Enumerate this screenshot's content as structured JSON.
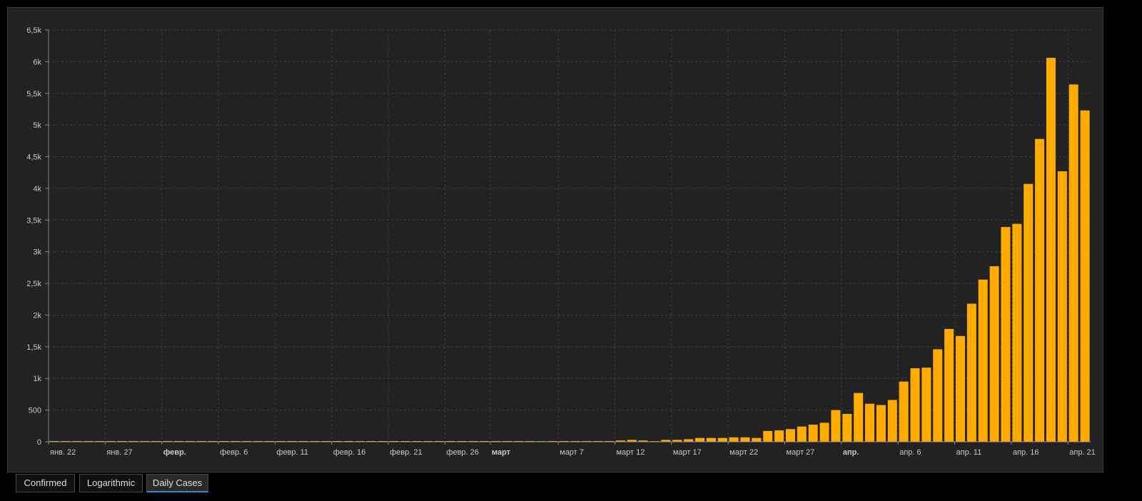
{
  "chart_data": {
    "type": "bar",
    "y_ticks": [
      {
        "value": 0,
        "label": "0"
      },
      {
        "value": 500,
        "label": "500"
      },
      {
        "value": 1000,
        "label": "1k"
      },
      {
        "value": 1500,
        "label": "1,5k"
      },
      {
        "value": 2000,
        "label": "2k"
      },
      {
        "value": 2500,
        "label": "2,5k"
      },
      {
        "value": 3000,
        "label": "3k"
      },
      {
        "value": 3500,
        "label": "3,5k"
      },
      {
        "value": 4000,
        "label": "4k"
      },
      {
        "value": 4500,
        "label": "4,5k"
      },
      {
        "value": 5000,
        "label": "5k"
      },
      {
        "value": 5500,
        "label": "5,5k"
      },
      {
        "value": 6000,
        "label": "6k"
      },
      {
        "value": 6500,
        "label": "6,5k"
      }
    ],
    "ylim": [
      0,
      6500
    ],
    "x_ticks": [
      {
        "index": 0,
        "label": "янв. 22",
        "bold": false
      },
      {
        "index": 5,
        "label": "янв. 27",
        "bold": false
      },
      {
        "index": 10,
        "label": "февр.",
        "bold": true
      },
      {
        "index": 15,
        "label": "февр. 6",
        "bold": false
      },
      {
        "index": 20,
        "label": "февр. 11",
        "bold": false
      },
      {
        "index": 25,
        "label": "февр. 16",
        "bold": false
      },
      {
        "index": 30,
        "label": "февр. 21",
        "bold": false
      },
      {
        "index": 35,
        "label": "февр. 26",
        "bold": false
      },
      {
        "index": 39,
        "label": "март",
        "bold": true
      },
      {
        "index": 45,
        "label": "март 7",
        "bold": false
      },
      {
        "index": 50,
        "label": "март 12",
        "bold": false
      },
      {
        "index": 55,
        "label": "март 17",
        "bold": false
      },
      {
        "index": 60,
        "label": "март 22",
        "bold": false
      },
      {
        "index": 65,
        "label": "март 27",
        "bold": false
      },
      {
        "index": 70,
        "label": "апр.",
        "bold": true
      },
      {
        "index": 75,
        "label": "апр. 6",
        "bold": false
      },
      {
        "index": 80,
        "label": "апр. 11",
        "bold": false
      },
      {
        "index": 85,
        "label": "апр. 16",
        "bold": false
      },
      {
        "index": 90,
        "label": "апр. 21",
        "bold": false
      }
    ],
    "values": [
      0,
      0,
      0,
      0,
      0,
      0,
      0,
      0,
      0,
      0,
      0,
      0,
      0,
      0,
      0,
      0,
      0,
      0,
      0,
      0,
      0,
      0,
      0,
      0,
      0,
      0,
      0,
      0,
      0,
      0,
      0,
      0,
      0,
      0,
      0,
      0,
      0,
      0,
      0,
      0,
      0,
      0,
      0,
      10,
      0,
      0,
      0,
      0,
      0,
      0,
      20,
      30,
      20,
      10,
      30,
      30,
      40,
      60,
      60,
      60,
      70,
      70,
      60,
      170,
      180,
      200,
      240,
      270,
      300,
      500,
      440,
      770,
      600,
      580,
      660,
      950,
      1160,
      1170,
      1460,
      1780,
      1670,
      2180,
      2560,
      2770,
      3390,
      3440,
      4070,
      4780,
      6060,
      4270,
      5640,
      5230
    ],
    "bar_color": "#ffab00",
    "grid": true
  },
  "tabs": [
    {
      "label": "Confirmed",
      "active": false
    },
    {
      "label": "Logarithmic",
      "active": false
    },
    {
      "label": "Daily Cases",
      "active": true
    }
  ]
}
